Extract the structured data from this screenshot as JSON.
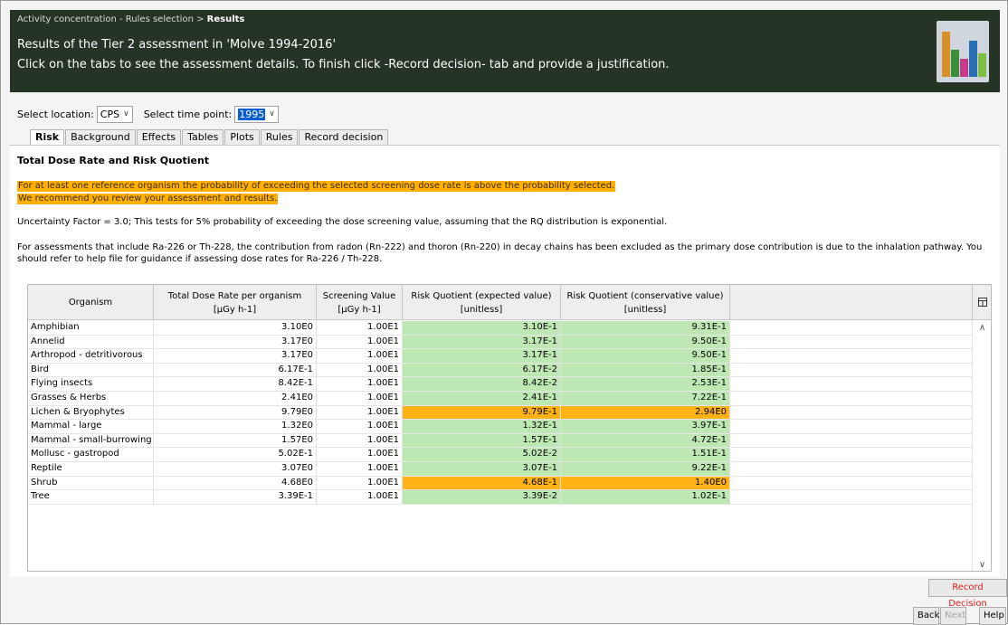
{
  "header": {
    "breadcrumb_prefix": "Activity concentration - Rules selection >",
    "breadcrumb_current": "Results",
    "title": "Results of the Tier 2 assessment in 'Molve 1994-2016'",
    "subtitle": "Click on the tabs to see the assessment details. To finish click -Record decision- tab and provide a justification."
  },
  "controls": {
    "location_label": "Select location:",
    "location_value": "CPS",
    "time_label": "Select time point:",
    "time_value": "1995"
  },
  "tabs": [
    "Risk",
    "Background",
    "Effects",
    "Tables",
    "Plots",
    "Rules",
    "Record decision"
  ],
  "panel": {
    "title": "Total Dose Rate and Risk Quotient",
    "warning_line1": "For at least one reference organism the probability of exceeding the selected screening dose rate is above the probability selected.",
    "warning_line2": "We recommend you review your assessment and results.",
    "uncertainty": "Uncertainty Factor = 3.0; This tests for 5% probability of exceeding the dose screening value, assuming that the RQ distribution is exponential.",
    "note": "For assessments that include Ra-226 or Th-228, the contribution from radon (Rn-222) and thoron (Rn-220) in decay chains has been excluded as the primary dose contribution is due to the inhalation pathway. You should refer to help file for guidance if assessing dose rates for Ra-226 / Th-228."
  },
  "table": {
    "headers": [
      {
        "l1": "Organism",
        "l2": ""
      },
      {
        "l1": "Total Dose Rate per organism",
        "l2": "[µGy h-1]"
      },
      {
        "l1": "Screening Value",
        "l2": "[µGy h-1]"
      },
      {
        "l1": "Risk Quotient (expected value)",
        "l2": "[unitless]"
      },
      {
        "l1": "Risk Quotient (conservative value)",
        "l2": "[unitless]"
      }
    ],
    "rows": [
      {
        "organism": "Amphibian",
        "dose": "3.10E0",
        "screening": "1.00E1",
        "rq_exp": "3.10E-1",
        "rq_cons": "9.31E-1",
        "flag": "green"
      },
      {
        "organism": "Annelid",
        "dose": "3.17E0",
        "screening": "1.00E1",
        "rq_exp": "3.17E-1",
        "rq_cons": "9.50E-1",
        "flag": "green"
      },
      {
        "organism": "Arthropod - detritivorous",
        "dose": "3.17E0",
        "screening": "1.00E1",
        "rq_exp": "3.17E-1",
        "rq_cons": "9.50E-1",
        "flag": "green"
      },
      {
        "organism": "Bird",
        "dose": "6.17E-1",
        "screening": "1.00E1",
        "rq_exp": "6.17E-2",
        "rq_cons": "1.85E-1",
        "flag": "green"
      },
      {
        "organism": "Flying insects",
        "dose": "8.42E-1",
        "screening": "1.00E1",
        "rq_exp": "8.42E-2",
        "rq_cons": "2.53E-1",
        "flag": "green"
      },
      {
        "organism": "Grasses & Herbs",
        "dose": "2.41E0",
        "screening": "1.00E1",
        "rq_exp": "2.41E-1",
        "rq_cons": "7.22E-1",
        "flag": "green"
      },
      {
        "organism": "Lichen & Bryophytes",
        "dose": "9.79E0",
        "screening": "1.00E1",
        "rq_exp": "9.79E-1",
        "rq_cons": "2.94E0",
        "flag": "orange"
      },
      {
        "organism": "Mammal - large",
        "dose": "1.32E0",
        "screening": "1.00E1",
        "rq_exp": "1.32E-1",
        "rq_cons": "3.97E-1",
        "flag": "green"
      },
      {
        "organism": "Mammal - small-burrowing",
        "dose": "1.57E0",
        "screening": "1.00E1",
        "rq_exp": "1.57E-1",
        "rq_cons": "4.72E-1",
        "flag": "green"
      },
      {
        "organism": "Mollusc - gastropod",
        "dose": "5.02E-1",
        "screening": "1.00E1",
        "rq_exp": "5.02E-2",
        "rq_cons": "1.51E-1",
        "flag": "green"
      },
      {
        "organism": "Reptile",
        "dose": "3.07E0",
        "screening": "1.00E1",
        "rq_exp": "3.07E-1",
        "rq_cons": "9.22E-1",
        "flag": "green"
      },
      {
        "organism": "Shrub",
        "dose": "4.68E0",
        "screening": "1.00E1",
        "rq_exp": "4.68E-1",
        "rq_cons": "1.40E0",
        "flag": "orange"
      },
      {
        "organism": "Tree",
        "dose": "3.39E-1",
        "screening": "1.00E1",
        "rq_exp": "3.39E-2",
        "rq_cons": "1.02E-1",
        "flag": "green"
      }
    ]
  },
  "buttons": {
    "record": "Record Decision",
    "back": "Back",
    "next": "Next",
    "help": "Help"
  },
  "colors": {
    "header_bg": "#263426",
    "warning": "#ffb000",
    "rq_ok": "#bde8b3",
    "rq_exceed": "#ffb316"
  },
  "icons": {
    "logo": "bar-chart-logo-icon",
    "column_chooser": "column-chooser-icon"
  }
}
